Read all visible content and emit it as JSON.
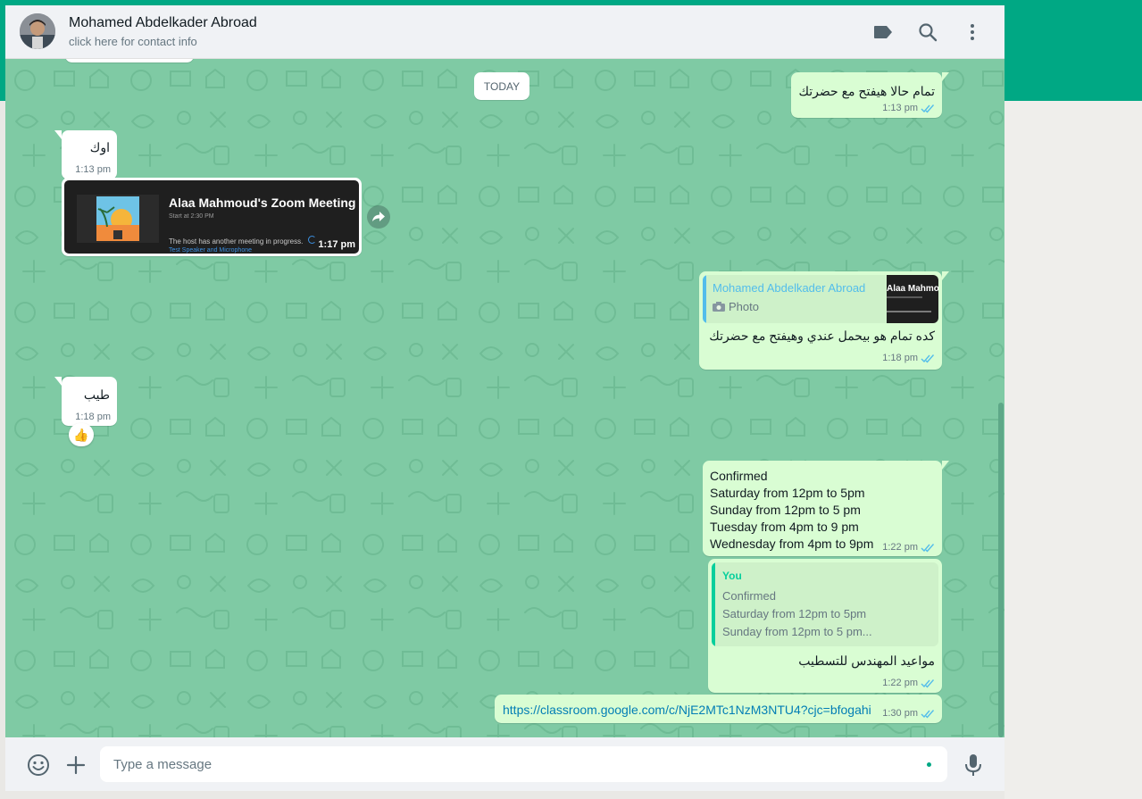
{
  "header": {
    "contact_name": "Mohamed Abdelkader Abroad",
    "contact_subtitle": "click here for contact info",
    "icons": [
      "label-icon",
      "search-icon",
      "menu-dots-icon"
    ]
  },
  "chat": {
    "date_divider": "TODAY",
    "messages": [
      {
        "direction": "out",
        "text": "تمام حالا هيفتح مع حضرتك",
        "time": "1:13 pm",
        "status": "read"
      },
      {
        "direction": "in",
        "text": "اوك",
        "time": "1:13 pm"
      },
      {
        "direction": "in",
        "type": "image",
        "image_title": "Alaa Mahmoud's Zoom Meeting",
        "image_sub": "Start at 2:30 PM",
        "image_body": "The host has another meeting in progress.",
        "image_link": "Test Speaker and Microphone",
        "time": "1:17 pm"
      },
      {
        "direction": "out",
        "quote_author": "Mohamed Abdelkader Abroad",
        "quote_text": "Photo",
        "quote_thumb_text": "Alaa Mahmou",
        "text": "كده تمام هو بيحمل عندي وهيفتح مع حضرتك",
        "time": "1:18 pm",
        "status": "read"
      },
      {
        "direction": "in",
        "text": "طيب",
        "time": "1:18 pm",
        "reaction": "👍"
      },
      {
        "direction": "out",
        "lines": [
          "Confirmed",
          "Saturday from 12pm to 5pm",
          "Sunday from 12pm to 5 pm",
          "Tuesday from 4pm to 9 pm",
          "Wednesday from 4pm to 9pm"
        ],
        "time": "1:22 pm",
        "status": "read"
      },
      {
        "direction": "out",
        "quote_author": "You",
        "quote_lines": [
          "Confirmed",
          "Saturday from 12pm to 5pm",
          "Sunday from 12pm to 5 pm..."
        ],
        "text": "مواعيد المهندس للتسطيب",
        "time": "1:22 pm",
        "status": "read"
      },
      {
        "direction": "out",
        "link": "https://classroom.google.com/c/NjE2MTc1NzM3NTU4?cjc=bfogahi",
        "time": "1:30 pm",
        "status": "read"
      }
    ]
  },
  "footer": {
    "input_placeholder": "Type a message",
    "icons": [
      "emoji-icon",
      "attach-plus-icon",
      "microphone-icon"
    ]
  },
  "colors": {
    "accent": "#00a884",
    "chat_background": "#7fcaa4",
    "outgoing_bubble": "#d9fdd3",
    "incoming_bubble": "#ffffff",
    "quote_author_contact": "#53bdeb",
    "quote_author_you": "#06cf9c",
    "read_tick": "#53bdeb",
    "link": "#027eb5"
  }
}
